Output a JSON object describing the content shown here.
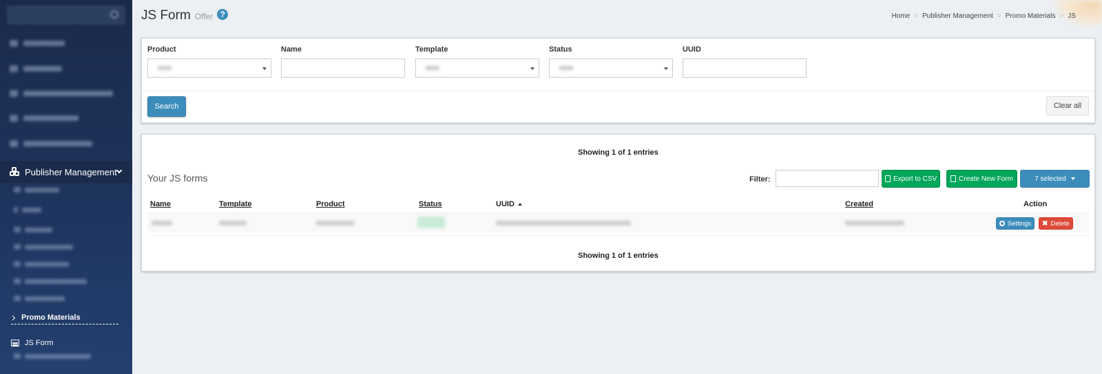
{
  "sidebar": {
    "publisher_management": "Publisher Management",
    "promo_materials": "Promo Materials",
    "js_form": "JS Form"
  },
  "header": {
    "title": "JS Form",
    "subtitle": "Offer",
    "help_glyph": "?",
    "breadcrumb": [
      "Home",
      "Publisher Management",
      "Promo Materials",
      "JS"
    ],
    "breadcrumb_sep": ">"
  },
  "filters": {
    "product_label": "Product",
    "name_label": "Name",
    "template_label": "Template",
    "status_label": "Status",
    "uuid_label": "UUID",
    "search_button": "Search",
    "clear_button": "Clear all"
  },
  "list": {
    "showing_top": "Showing 1 of 1 entries",
    "showing_bottom": "Showing 1 of 1 entries",
    "title": "Your JS forms",
    "filter_label": "Filter:",
    "export_button": "Export to CSV",
    "create_button": "Create New Form",
    "columns_button": "7 selected",
    "columns": {
      "name": "Name",
      "template": "Template",
      "product": "Product",
      "status": "Status",
      "uuid": "UUID",
      "created": "Created",
      "action": "Action"
    },
    "row_actions": {
      "settings": "Settings",
      "delete": "Delete"
    }
  },
  "colors": {
    "sidebar_bg": "#1f3560",
    "primary": "#3c8dbc",
    "success": "#00a65a",
    "danger": "#dd4b39",
    "page_bg": "#ecf0f5"
  }
}
